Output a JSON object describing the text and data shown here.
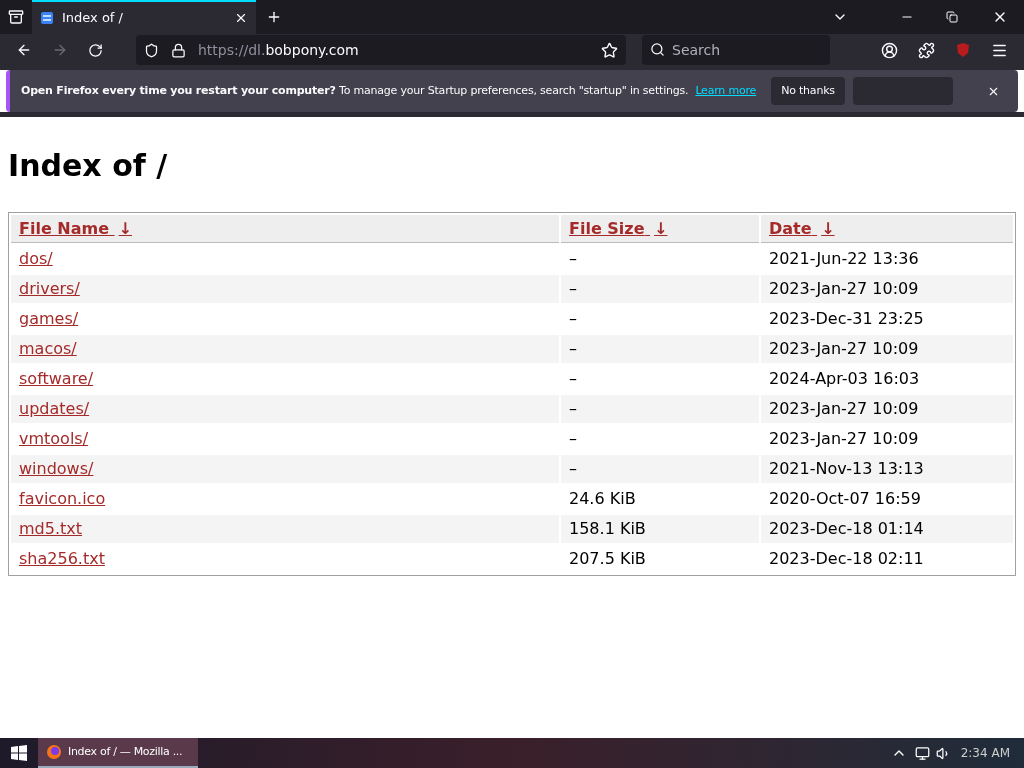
{
  "tabs": [
    {
      "title": "Index of /",
      "selected": true
    }
  ],
  "address": {
    "prefix": "https://dl.",
    "host": "bobpony.com"
  },
  "search": {
    "placeholder": "Search"
  },
  "notification": {
    "bold": "Open Firefox every time you restart your computer?",
    "text": "To manage your Startup preferences, search \"startup\" in settings.",
    "link": "Learn more",
    "button": "No thanks"
  },
  "page": {
    "heading": "Index of /",
    "columns": [
      {
        "label": "File Name",
        "sort": "↓"
      },
      {
        "label": "File Size",
        "sort": "↓"
      },
      {
        "label": "Date",
        "sort": "↓"
      }
    ],
    "rows": [
      {
        "name": "dos/",
        "size": "–",
        "date": "2021-Jun-22 13:36"
      },
      {
        "name": "drivers/",
        "size": "–",
        "date": "2023-Jan-27 10:09"
      },
      {
        "name": "games/",
        "size": "–",
        "date": "2023-Dec-31 23:25"
      },
      {
        "name": "macos/",
        "size": "–",
        "date": "2023-Jan-27 10:09"
      },
      {
        "name": "software/",
        "size": "–",
        "date": "2024-Apr-03 16:03"
      },
      {
        "name": "updates/",
        "size": "–",
        "date": "2023-Jan-27 10:09"
      },
      {
        "name": "vmtools/",
        "size": "–",
        "date": "2023-Jan-27 10:09"
      },
      {
        "name": "windows/",
        "size": "–",
        "date": "2021-Nov-13 13:13"
      },
      {
        "name": "favicon.ico",
        "size": "24.6 KiB",
        "date": "2020-Oct-07 16:59"
      },
      {
        "name": "md5.txt",
        "size": "158.1 KiB",
        "date": "2023-Dec-18 01:14"
      },
      {
        "name": "sha256.txt",
        "size": "207.5 KiB",
        "date": "2023-Dec-18 02:11"
      }
    ]
  },
  "taskbar": {
    "items": [
      {
        "title": "Index of / — Mozilla ...",
        "selected": true
      }
    ],
    "clock": "2:34 AM"
  }
}
